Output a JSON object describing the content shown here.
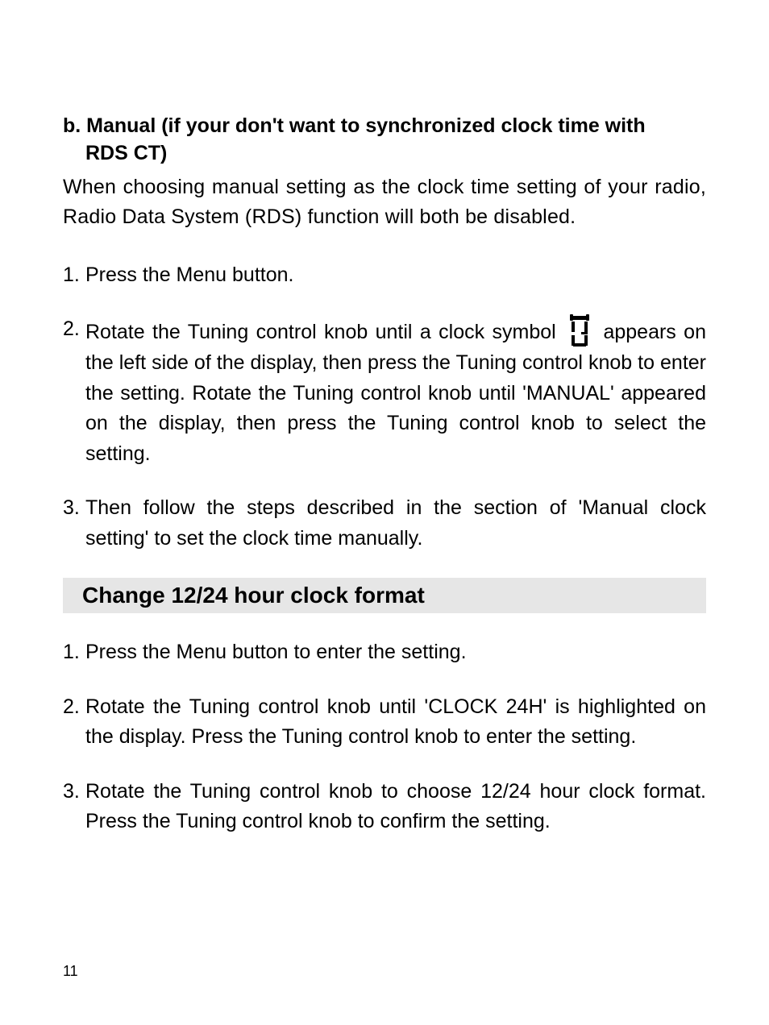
{
  "section_b": {
    "heading_line1": "b. Manual (if your don't want to synchronized clock time with",
    "heading_line2": "RDS CT)",
    "intro": "When choosing manual setting as the clock time setting of your radio,  Radio Data System (RDS) function will both be disabled.",
    "steps": {
      "s1_num": "1.",
      "s1_body": "Press the Menu button.",
      "s2_num": "2.",
      "s2_pre": "Rotate the Tuning control knob until a clock symbol ",
      "s2_post": " appears on the left side of the display, then press the Tuning control knob to enter the setting. Rotate the Tuning control knob until 'MANUAL' appeared on the display, then press the Tuning control knob to select the setting.",
      "s3_num": "3.",
      "s3_body": "Then follow the steps described in the section of 'Manual clock setting' to set the clock time manually."
    }
  },
  "section_format": {
    "heading": "Change 12/24 hour clock format",
    "steps": {
      "s1_num": "1.",
      "s1_body": "Press the Menu button to enter the setting.",
      "s2_num": "2.",
      "s2_body": "Rotate the Tuning control knob until 'CLOCK 24H' is highlighted on the display. Press the Tuning control knob to enter the setting.",
      "s3_num": "3.",
      "s3_body": "Rotate the Tuning control knob to choose 12/24 hour clock format. Press the Tuning control knob to confirm the setting."
    }
  },
  "page_number": "11",
  "icons": {
    "clock": "clock-icon"
  }
}
